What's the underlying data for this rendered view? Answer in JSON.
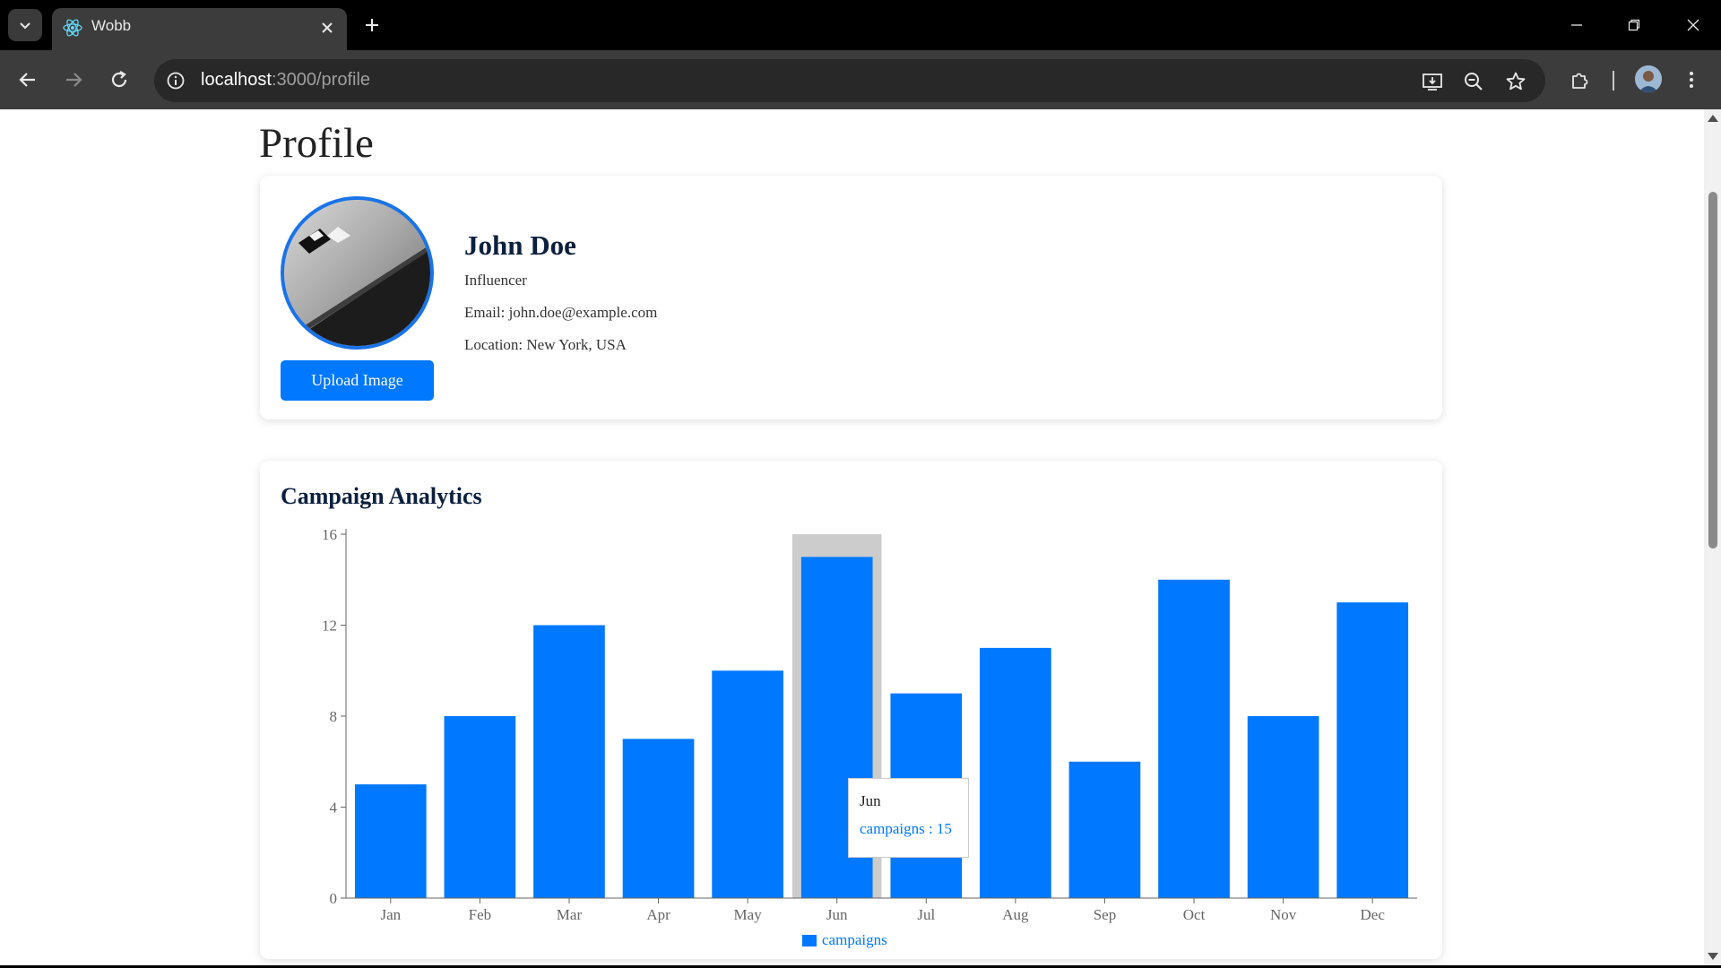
{
  "browser": {
    "tab_title": "Wobb",
    "url_host": "localhost",
    "url_rest": ":3000/profile"
  },
  "page": {
    "title": "Profile"
  },
  "profile": {
    "name": "John Doe",
    "role": "Influencer",
    "email": "Email: john.doe@example.com",
    "location": "Location: New York, USA",
    "upload_label": "Upload Image"
  },
  "analytics": {
    "title": "Campaign Analytics",
    "tooltip": {
      "label": "Jun",
      "value": "campaigns : 15"
    },
    "legend_label": "campaigns"
  },
  "colors": {
    "accent": "#0078ff",
    "highlight": "#cccccc",
    "heading": "#0c1f3d"
  },
  "chart_data": {
    "type": "bar",
    "categories": [
      "Jan",
      "Feb",
      "Mar",
      "Apr",
      "May",
      "Jun",
      "Jul",
      "Aug",
      "Sep",
      "Oct",
      "Nov",
      "Dec"
    ],
    "series": [
      {
        "name": "campaigns",
        "values": [
          5,
          8,
          12,
          7,
          10,
          15,
          9,
          11,
          6,
          14,
          8,
          13
        ]
      }
    ],
    "yticks": [
      0,
      4,
      8,
      12,
      16
    ],
    "ylim": [
      0,
      16
    ],
    "highlighted_category": "Jun",
    "legend": "bottom-center",
    "grid": false
  }
}
